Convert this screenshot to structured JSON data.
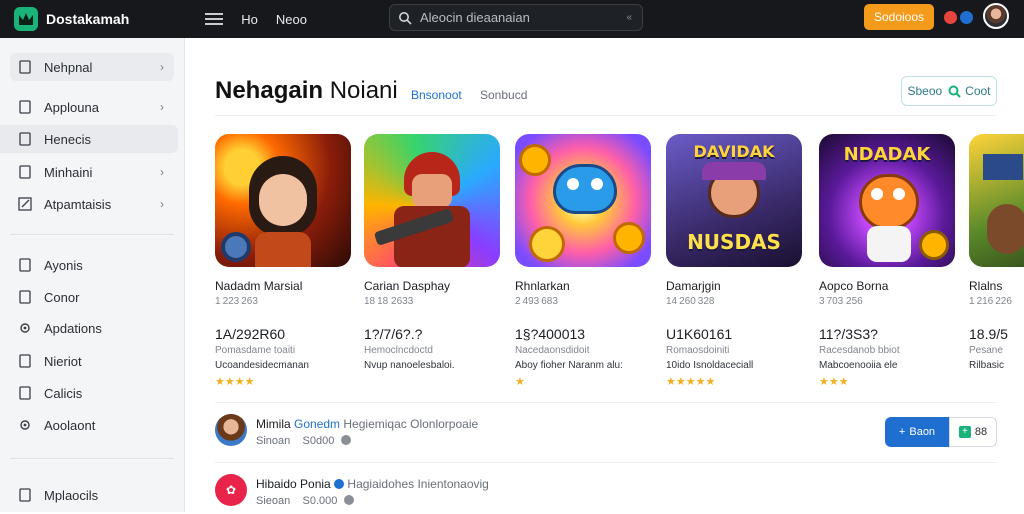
{
  "header": {
    "brand": "Dostakamah",
    "nav": [
      "Ho",
      "Neoo"
    ],
    "search_placeholder": "Aleocin dieaanaian",
    "search_clear": "«",
    "signin_label": "Sodoioos",
    "dot_colors": [
      "#e8453c",
      "#1f6fd1"
    ]
  },
  "sidebar": {
    "items": [
      {
        "label": "Nehpnal",
        "icon": "page-icon",
        "chevron": "›"
      },
      {
        "label": "Applouna",
        "icon": "page-icon",
        "chevron": "›"
      },
      {
        "label": "Henecis",
        "icon": "page-icon",
        "chevron": ""
      },
      {
        "label": "Minhaini",
        "icon": "page-icon",
        "chevron": "›"
      },
      {
        "label": "Atpamtaisis",
        "icon": "edit-icon",
        "chevron": "›"
      },
      {
        "label": "Ayonis",
        "icon": "page-icon",
        "chevron": ""
      },
      {
        "label": "Conor",
        "icon": "page-icon",
        "chevron": ""
      },
      {
        "label": "Apdations",
        "icon": "settings-icon",
        "chevron": ""
      },
      {
        "label": "Nieriot",
        "icon": "page-icon",
        "chevron": ""
      },
      {
        "label": "Calicis",
        "icon": "page-icon",
        "chevron": ""
      },
      {
        "label": "Aoolaont",
        "icon": "settings-icon",
        "chevron": ""
      },
      {
        "label": "Mplaocils",
        "icon": "page-icon",
        "chevron": ""
      }
    ]
  },
  "main": {
    "title_bold": "Nehagain",
    "title_rest": " Noiani",
    "tab_active": "Bnsonoot",
    "tab_other": "Sonbucd",
    "view_button": "Sbeoo",
    "view_button_count": "Coot",
    "cards": [
      {
        "name": "Nadadm Marsial",
        "sub": "1 223 263",
        "price": "1A/292R60",
        "meta": "Pomasdame toaiti",
        "desc": "Ucoandesidecmanan",
        "stars": "★★★★",
        "art": "dark-hero"
      },
      {
        "name": "Carian Dasphay",
        "sub": "18 18 2633",
        "price": "1?/7/6?.?",
        "meta": "Hemoclncdoctd",
        "desc": "Nvup nanoelesbaloi.",
        "stars": "",
        "art": "soldier"
      },
      {
        "name": "Rhnlarkan",
        "sub": "2 493 683",
        "price": "1§?400013",
        "meta": "Nacedaonsdidoit",
        "desc": "Aboy fioher Naranm alu:",
        "stars": "★",
        "art": "fish"
      },
      {
        "name": "Damarjgin",
        "sub": "14 260 328",
        "price": "U1K60161",
        "meta": "Romaosdoiniti",
        "desc": "10ido Isnoldaceciall",
        "stars": "★★★★★",
        "art": "nusdas",
        "art_text": "NUSDAS",
        "art_top": "DAVIDAK"
      },
      {
        "name": "Aopco Borna",
        "sub": "3 703 256",
        "price": "11?/3S3?",
        "meta": "Racesdanob bbiot",
        "desc": "Mabcoenooiia ele",
        "stars": "★★★",
        "art": "duck",
        "art_top": "NDADAK"
      },
      {
        "name": "Rlalns",
        "sub": "1 216 226",
        "price": "18.9/5",
        "meta": "Pesane",
        "desc": "Rilbasic",
        "stars": "",
        "art": "partial"
      }
    ],
    "list": [
      {
        "title": "Mimila",
        "highlight": "Gonedm",
        "rest": "Hegiemiqac",
        "extra": "Olonlorpoaie",
        "sub_a": "Sinoan",
        "sub_b": "S0d00",
        "follow": "Baon",
        "count": "88"
      },
      {
        "title": "Hibaido Ponia",
        "highlight": "",
        "rest": "Hagiaidohes",
        "extra": "Inientonaovig",
        "sub_a": "Sieoan",
        "sub_b": "S0.000"
      }
    ]
  }
}
